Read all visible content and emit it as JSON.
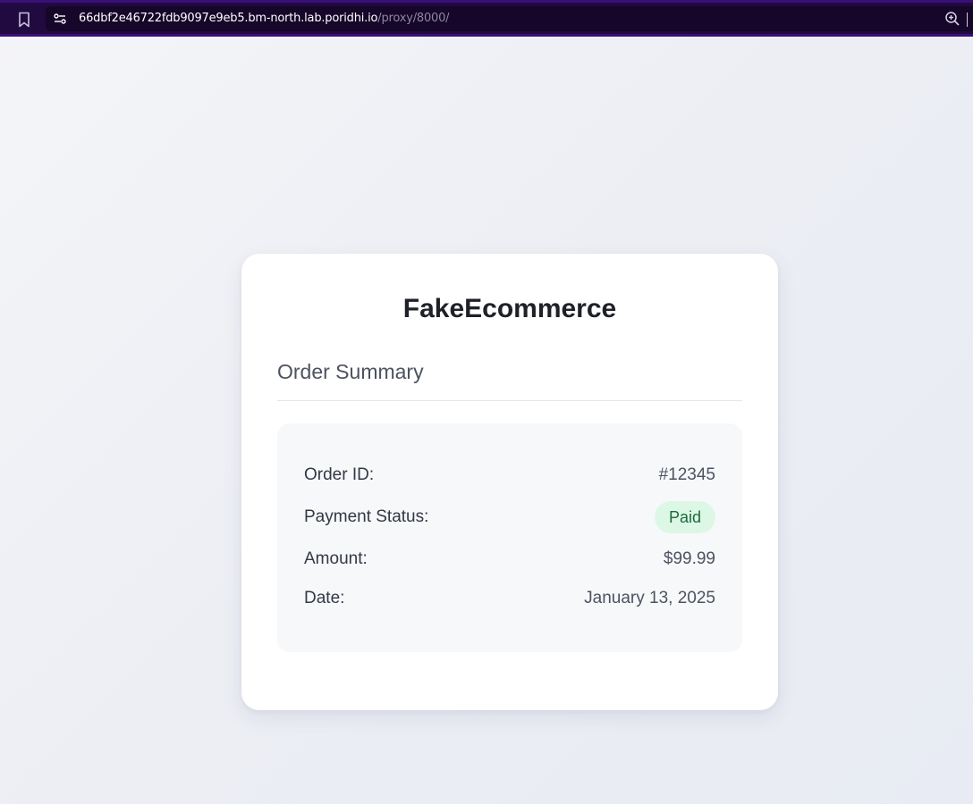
{
  "browser": {
    "url_host": "66dbf2e46722fdb9097e9eb5.bm-north.lab.poridhi.io",
    "url_path": "/proxy/8000/",
    "icons": {
      "bookmark": "bookmark-icon",
      "site_info": "site-info-icon",
      "zoom": "zoom-in-icon"
    },
    "colors": {
      "bar_bg": "#200a3f",
      "url_bg": "#160629"
    }
  },
  "page": {
    "brand": "FakeEcommerce",
    "section_title": "Order Summary",
    "rows": [
      {
        "label": "Order ID:",
        "value": "#12345"
      },
      {
        "label": "Payment Status:",
        "value": "Paid"
      },
      {
        "label": "Amount:",
        "value": "$99.99"
      },
      {
        "label": "Date:",
        "value": "January 13, 2025"
      }
    ],
    "colors": {
      "badge_bg": "#dcf7e6",
      "badge_text": "#1f6a3d"
    }
  }
}
